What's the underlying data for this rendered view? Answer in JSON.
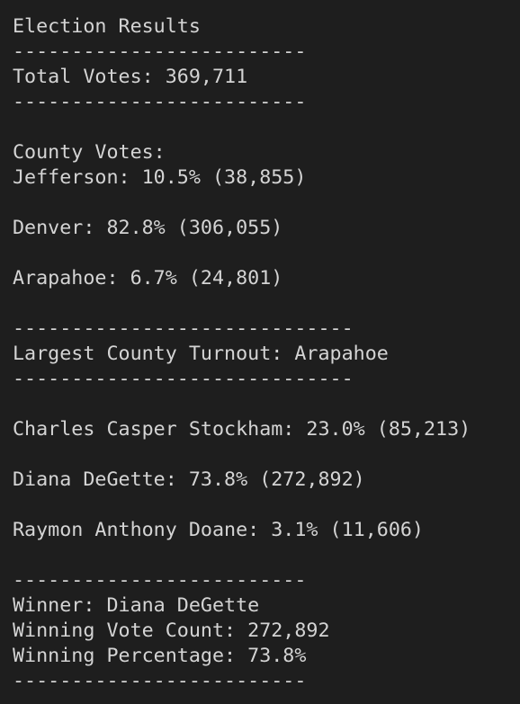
{
  "terminal": {
    "lines": [
      "Election Results",
      "-------------------------",
      "Total Votes: 369,711",
      "-------------------------",
      "",
      "County Votes:",
      "Jefferson: 10.5% (38,855)",
      "",
      "Denver: 82.8% (306,055)",
      "",
      "Arapahoe: 6.7% (24,801)",
      "",
      "-----------------------------",
      "Largest County Turnout: Arapahoe",
      "-----------------------------",
      "",
      "Charles Casper Stockham: 23.0% (85,213)",
      "",
      "Diana DeGette: 73.8% (272,892)",
      "",
      "Raymon Anthony Doane: 3.1% (11,606)",
      "",
      "-------------------------",
      "Winner: Diana DeGette",
      "Winning Vote Count: 272,892",
      "Winning Percentage: 73.8%",
      "-------------------------"
    ]
  }
}
